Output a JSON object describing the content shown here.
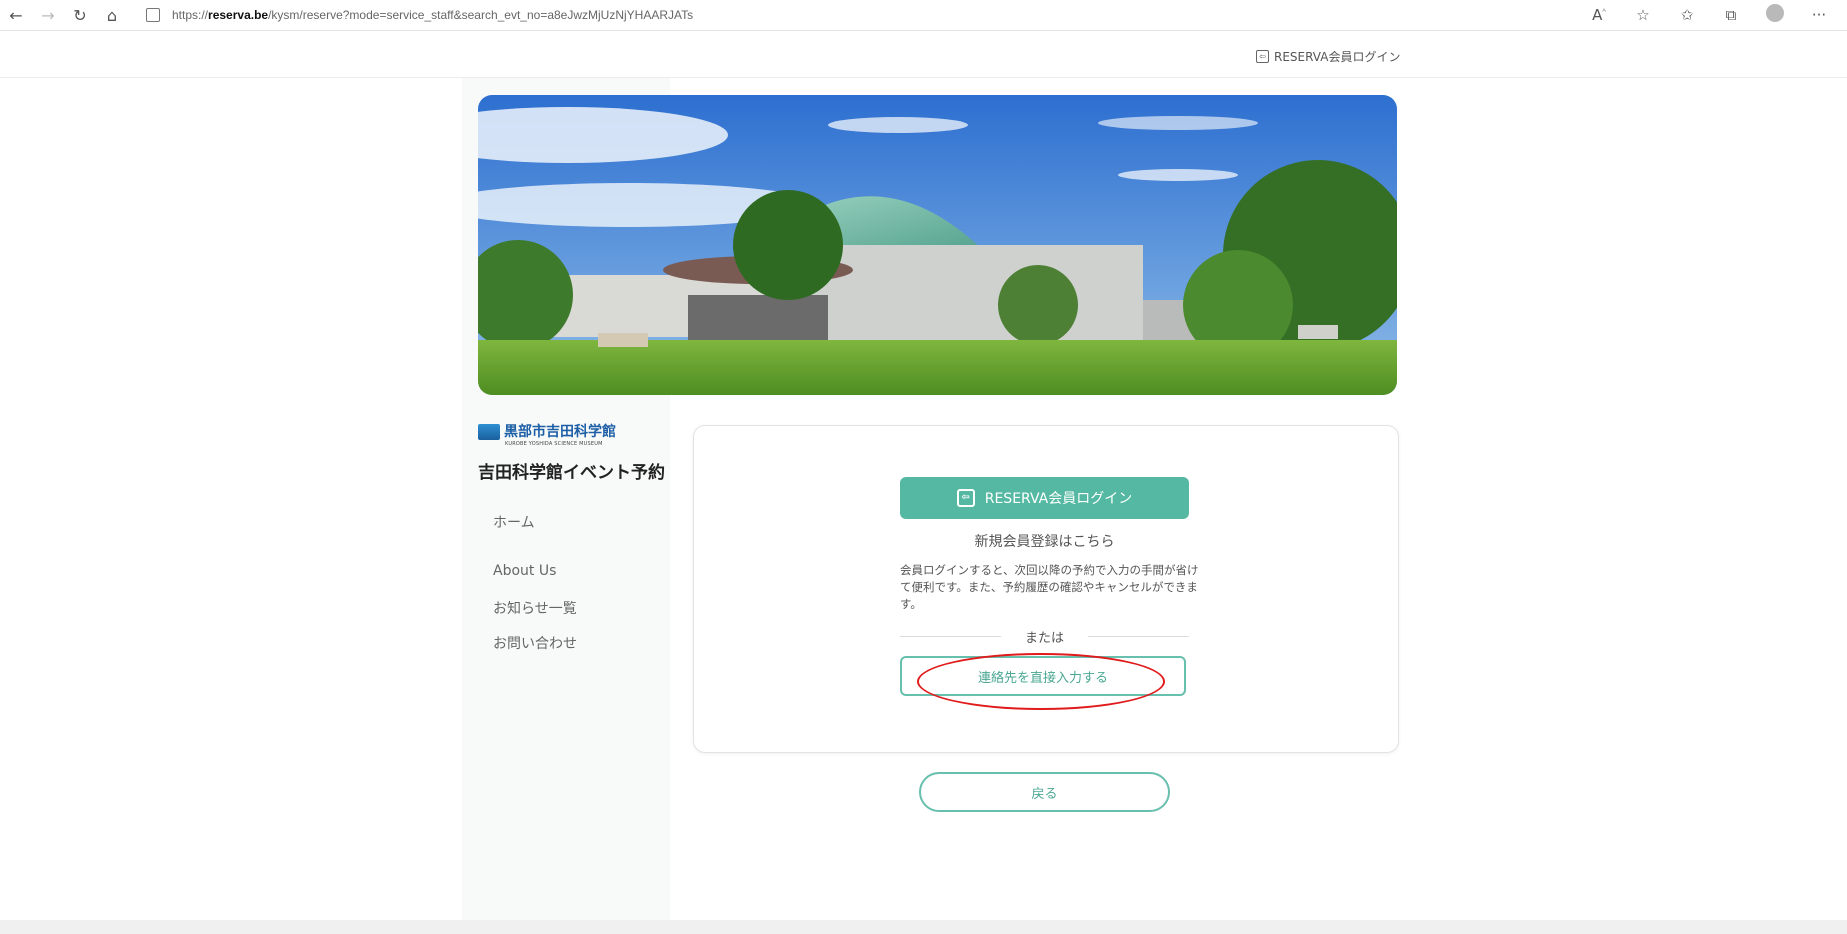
{
  "browser": {
    "url_prefix": "https://",
    "url_host": "reserva.be",
    "url_path": "/kysm/reserve?mode=service_staff&search_evt_no=a8eJwzMjUzNjYHAARJATs"
  },
  "header": {
    "login_label": "RESERVA会員ログイン"
  },
  "sidebar": {
    "brand_name": "黒部市吉田科学館",
    "brand_subtitle": "KUROBE YOSHIDA SCIENCE MUSEUM",
    "site_title": "吉田科学館イベント予約",
    "nav": [
      "ホーム",
      "About Us",
      "お知らせ一覧",
      "お問い合わせ"
    ]
  },
  "card": {
    "login_button": "RESERVA会員ログイン",
    "register_link": "新規会員登録はこちら",
    "description": "会員ログインすると、次回以降の予約で入力の手間が省けて便利です。また、予約履歴の確認やキャンセルができます。",
    "or_label": "または",
    "direct_button": "連絡先を直接入力する"
  },
  "back_button": "戻る",
  "colors": {
    "accent": "#55b8a2",
    "annotation": "#e01b1b",
    "brand": "#1d5fa6"
  },
  "icons": [
    "back-arrow-icon",
    "forward-arrow-icon",
    "refresh-icon",
    "home-icon",
    "lock-icon",
    "read-aloud-icon",
    "favorite-icon",
    "favorites-list-icon",
    "collections-icon",
    "profile-icon",
    "more-icon",
    "login-icon"
  ]
}
